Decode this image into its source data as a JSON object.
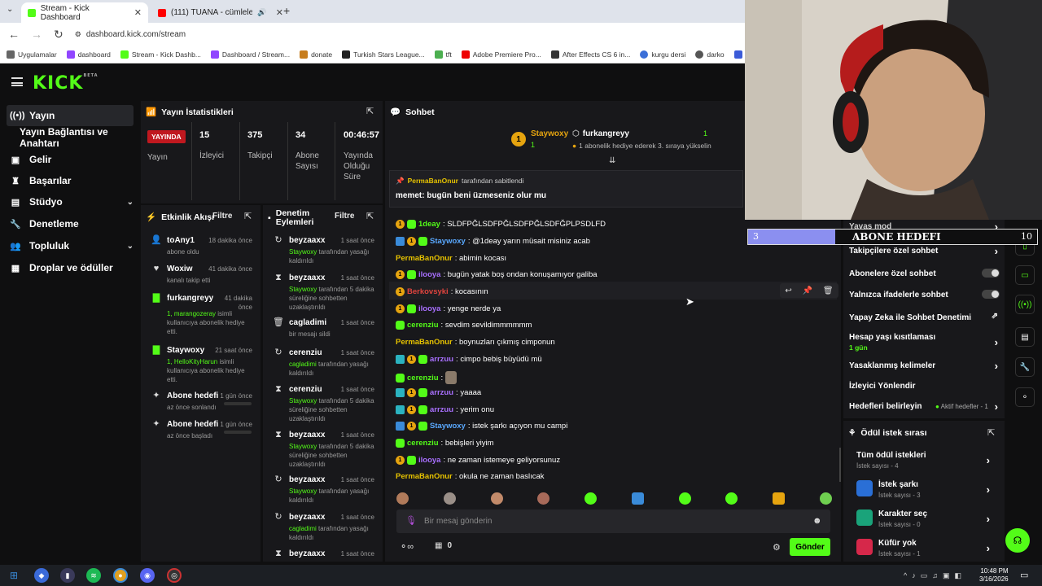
{
  "browser": {
    "tabs": [
      {
        "title": "Stream - Kick Dashboard"
      },
      {
        "title": "(111) TUANA - cümlelerim"
      }
    ],
    "url": "dashboard.kick.com/stream",
    "bookmarks": [
      "Uygulamalar",
      "dashboard",
      "Stream - Kick Dashb...",
      "Dashboard / Stream...",
      "donate",
      "Turkish Stars League...",
      "tft",
      "Adobe Premiere Pro...",
      "After Effects CS 6 in...",
      "kurgu dersi",
      "darko",
      "coinm"
    ]
  },
  "brand": {
    "logo": "KICK",
    "beta": "BETA",
    "accent": "#53fc18"
  },
  "nav": [
    {
      "label": "Yayın",
      "icon": "broadcast-icon"
    },
    {
      "label": "Yayın Bağlantısı ve Anahtarı"
    },
    {
      "label": "Gelir",
      "icon": "wallet-icon"
    },
    {
      "label": "Başarılar",
      "icon": "trophy-icon"
    },
    {
      "label": "Stüdyo",
      "icon": "studio-icon"
    },
    {
      "label": "Denetleme",
      "icon": "wrench-icon"
    },
    {
      "label": "Topluluk",
      "icon": "people-icon"
    },
    {
      "label": "Droplar ve ödüller",
      "icon": "gift-icon"
    }
  ],
  "stats": {
    "title": "Yayın İstatistikleri",
    "status": "YAYINDA",
    "status_sub": "Yayın",
    "viewers": "15",
    "viewers_label": "İzleyici",
    "followers": "375",
    "followers_label": "Takipçi",
    "subs": "34",
    "subs_label": "Abone Sayısı",
    "uptime": "00:46:57",
    "uptime_label": "Yayında Olduğu Süre"
  },
  "activity": {
    "title": "Etkinlik Akışı",
    "filter": "Filtre",
    "items": [
      {
        "name": "toAny1",
        "time": "18 dakika önce",
        "desc": "abone oldu"
      },
      {
        "name": "Woxiw",
        "time": "41 dakika önce",
        "desc": "kanalı takip etti"
      },
      {
        "name": "furkangreyy",
        "time": "41 dakika önce",
        "user": "1, marangozeray",
        "desc": "isimli kullanıcıya abonelik hediye etti."
      },
      {
        "name": "Staywoxy",
        "time": "21 saat önce",
        "user": "1, HelloKityHarun",
        "desc": "isimli kullanıcıya abonelik hediye etti."
      },
      {
        "name": "Abone hedefi",
        "time": "1 gün önce",
        "desc": "az önce sonlandı"
      },
      {
        "name": "Abone hedefi",
        "time": "1 gün önce",
        "desc": "az önce başladı"
      }
    ]
  },
  "moderation": {
    "title": "Denetim Eylemleri",
    "filter": "Filtre",
    "items": [
      {
        "name": "beyzaaxx",
        "time": "1 saat önce",
        "user": "Staywoxy",
        "desc": "tarafından yasağı kaldırıldı"
      },
      {
        "name": "beyzaaxx",
        "time": "1 saat önce",
        "user": "Staywoxy",
        "desc": "tarafından 5 dakika süreliğine sohbetten uzaklaştırıldı"
      },
      {
        "name": "cagladimi",
        "time": "1 saat önce",
        "desc": "bir mesajı sildi"
      },
      {
        "name": "cerenziu",
        "time": "1 saat önce",
        "user": "cagladimi",
        "desc": "tarafından yasağı kaldırıldı"
      },
      {
        "name": "cerenziu",
        "time": "1 saat önce",
        "user": "Staywoxy",
        "desc": "tarafından 5 dakika süreliğine sohbetten uzaklaştırıldı"
      },
      {
        "name": "beyzaaxx",
        "time": "1 saat önce",
        "user": "Staywoxy",
        "desc": "tarafından 5 dakika süreliğine sohbetten uzaklaştırıldı"
      },
      {
        "name": "beyzaaxx",
        "time": "1 saat önce",
        "user": "Staywoxy",
        "desc": "tarafından yasağı kaldırıldı"
      },
      {
        "name": "beyzaaxx",
        "time": "1 saat önce",
        "user": "cagladimi",
        "desc": "tarafından yasağı kaldırıldı"
      },
      {
        "name": "beyzaaxx",
        "time": "1 saat önce"
      }
    ]
  },
  "chat": {
    "title": "Sohbet",
    "top_gifter": {
      "rank": "1",
      "name": "Staywoxy",
      "count": "1"
    },
    "gifter2": {
      "name": "furkangreyy",
      "count": "1",
      "note": "1 abonelik hediye ederek 3. sıraya yükselin"
    },
    "pinned": {
      "by": "PermaBanOnur",
      "by_suffix": "tarafından sabitlendi",
      "text": "memet: bugün beni üzmeseniz olur mu"
    },
    "messages": [
      {
        "user": "1deay",
        "text": ": SLDFPĞLSDFPĞLSDFPĞLSDFĞPLPSDLFD",
        "cls": "gn"
      },
      {
        "user": "Staywoxy",
        "text": ": @1deay yarın müsait misiniz acab",
        "cls": "bl"
      },
      {
        "user": "PermaBanOnur",
        "text": ": abimin kocası",
        "cls": "yl"
      },
      {
        "user": "ilooya",
        "text": ": bugün yatak boş ondan konuşamıyor galiba",
        "cls": "pu"
      },
      {
        "user": "Berkovsyki",
        "text": ": kocasının",
        "cls": "rd"
      },
      {
        "user": "ilooya",
        "text": ": yenge nerde ya",
        "cls": "pu"
      },
      {
        "user": "cerenziu",
        "text": ": sevdim sevildimmmmmm",
        "cls": "gn"
      },
      {
        "user": "PermaBanOnur",
        "text": ": boynuzları çıkmış cimponun",
        "cls": "yl"
      },
      {
        "user": "arrzuu",
        "text": ": cimpo bebiş büyüdü mü",
        "cls": "pu"
      },
      {
        "user": "cerenziu",
        "text": ":",
        "cls": "gn"
      },
      {
        "user": "arrzuu",
        "text": ": yaaaa",
        "cls": "pu"
      },
      {
        "user": "arrzuu",
        "text": ": yerim onu",
        "cls": "pu"
      },
      {
        "user": "Staywoxy",
        "text": ": istek şarkı açıyon mu campi",
        "cls": "bl"
      },
      {
        "user": "cerenziu",
        "text": ": bebişleri yiyim",
        "cls": "gn"
      },
      {
        "user": "ilooya",
        "text": ": ne zaman istemeye geliyorsunuz",
        "cls": "pu"
      },
      {
        "user": "PermaBanOnur",
        "text": ": okula ne zaman baslıcak",
        "cls": "yl"
      }
    ],
    "input_placeholder": "Bir mesaj gönderin",
    "points": "0",
    "send": "Gönder"
  },
  "settings": [
    {
      "label": "Yavaş mod"
    },
    {
      "label": "Takipçilere özel sohbet"
    },
    {
      "label": "Abonelere özel sohbet"
    },
    {
      "label": "Yalnızca ifadelerle sohbet"
    },
    {
      "label": "Yapay Zeka ile Sohbet Denetimi"
    },
    {
      "label": "Hesap yaşı kısıtlaması",
      "sub": "1 gün"
    },
    {
      "label": "Yasaklanmış kelimeler"
    },
    {
      "label": "İzleyici Yönlendir"
    },
    {
      "label": "Hedefleri belirleyin",
      "extra": "Aktif hedefler - 1"
    }
  ],
  "rewards": {
    "title": "Ödül istek sırası",
    "all": {
      "label": "Tüm ödül istekleri",
      "sub": "İstek sayısı - 4"
    },
    "items": [
      {
        "label": "İstek şarkı",
        "sub": "İstek sayısı - 3",
        "color": "#2a6fd6"
      },
      {
        "label": "Karakter seç",
        "sub": "İstek sayısı - 0",
        "color": "#1aa37a"
      },
      {
        "label": "Küfür yok",
        "sub": "İstek sayısı - 1",
        "color": "#d6284a"
      }
    ]
  },
  "overlay": {
    "goal_title": "ABONE HEDEFI",
    "goal_current": "3",
    "goal_target": "10",
    "goal_progress": 0.3
  },
  "clock": {
    "time": "10:48 PM",
    "date": "3/16/2026"
  }
}
